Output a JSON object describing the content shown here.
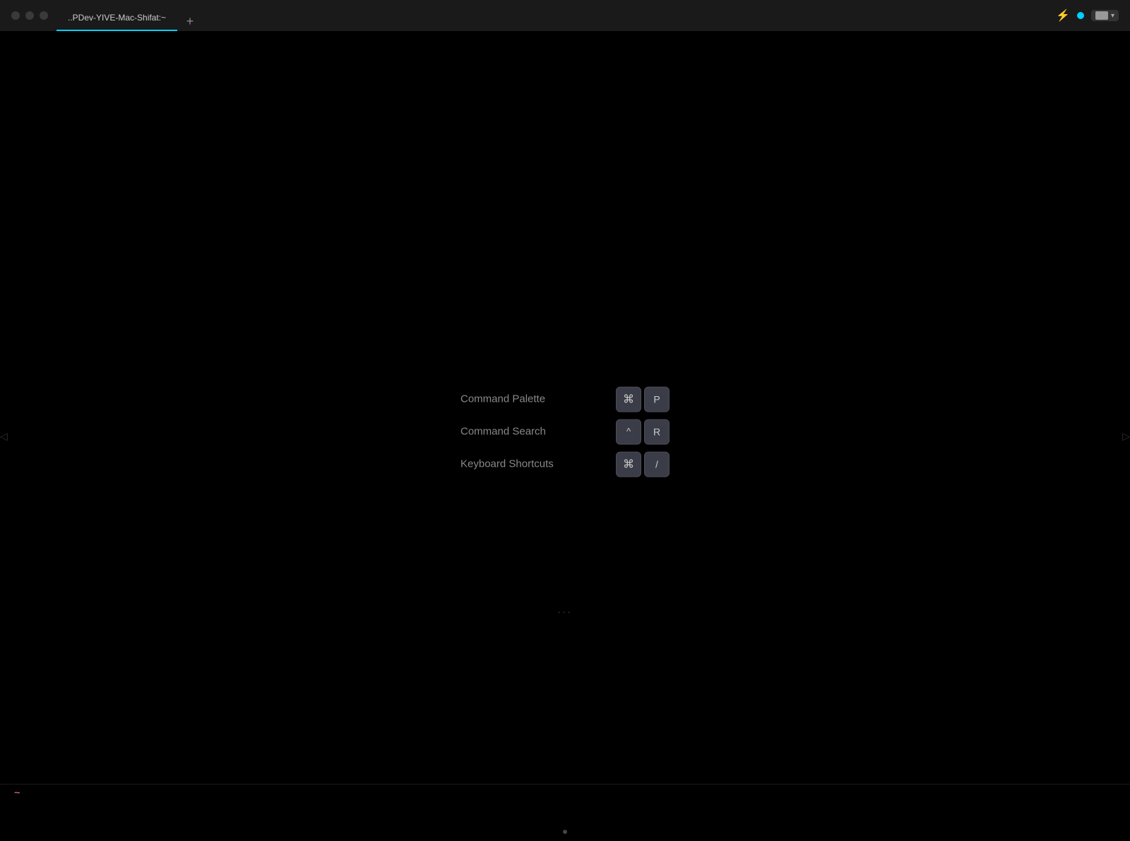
{
  "titlebar": {
    "tab_label": "..PDev-YIVE-Mac-Shifat:~",
    "add_tab_label": "+",
    "traffic_lights": [
      "close",
      "minimize",
      "maximize"
    ]
  },
  "shortcuts": [
    {
      "label": "Command Palette",
      "keys": [
        "⌘",
        "P"
      ]
    },
    {
      "label": "Command Search",
      "keys": [
        "^",
        "R"
      ]
    },
    {
      "label": "Keyboard Shortcuts",
      "keys": [
        "⌘",
        "/"
      ]
    }
  ],
  "prompt": {
    "symbol": "~"
  },
  "dots": "...",
  "colors": {
    "accent": "#00d0ff",
    "key_bg": "#3a3c47",
    "text_muted": "#888888"
  }
}
